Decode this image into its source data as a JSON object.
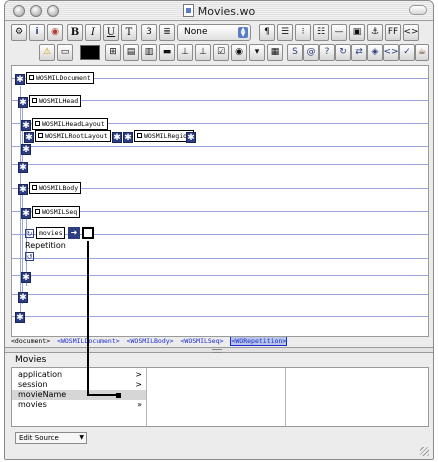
{
  "window": {
    "title": "Movies.wo"
  },
  "toolbar_row1": {
    "buttons": [
      {
        "name": "component-icon",
        "label": "⚙"
      },
      {
        "name": "info-icon",
        "label": "i"
      },
      {
        "name": "image-icon",
        "label": "◉"
      },
      {
        "name": "bold-button",
        "label": "B"
      },
      {
        "name": "italic-button",
        "label": "I"
      },
      {
        "name": "underline-button",
        "label": "U"
      },
      {
        "name": "teletype-button",
        "label": "T"
      },
      {
        "name": "superscript-button",
        "label": "3"
      },
      {
        "name": "paragraph-style-icon",
        "label": "≣"
      }
    ],
    "style_select": {
      "value": "None"
    },
    "right_buttons": [
      {
        "name": "paragraph-icon",
        "label": "¶"
      },
      {
        "name": "align-icon",
        "label": "☰"
      },
      {
        "name": "bulleted-list-icon",
        "label": "⁝"
      },
      {
        "name": "numbered-list-icon",
        "label": "☷"
      },
      {
        "name": "horizontal-rule-icon",
        "label": "—"
      },
      {
        "name": "image-insert-icon",
        "label": "▣"
      },
      {
        "name": "anchor-icon",
        "label": "⚓"
      },
      {
        "name": "frame-icon",
        "label": "FF"
      },
      {
        "name": "code-icon",
        "label": "<>"
      }
    ]
  },
  "toolbar_row2": {
    "buttons": [
      {
        "name": "warning-icon",
        "label": "⚠"
      },
      {
        "name": "cylinder-icon",
        "label": "▭"
      },
      {
        "name": "form-icon",
        "label": "⊞"
      },
      {
        "name": "text-field-icon",
        "label": "▤"
      },
      {
        "name": "text-area-icon",
        "label": "▥"
      },
      {
        "name": "button-icon",
        "label": "▬"
      },
      {
        "name": "submit-icon",
        "label": "⊥"
      },
      {
        "name": "reset-icon",
        "label": "⊥"
      },
      {
        "name": "checkbox-icon",
        "label": "☑"
      },
      {
        "name": "radio-icon",
        "label": "◉"
      },
      {
        "name": "popup-icon",
        "label": "▾"
      },
      {
        "name": "list-icon",
        "label": "▦"
      }
    ],
    "right_buttons": [
      {
        "name": "string-icon",
        "label": "S"
      },
      {
        "name": "hyperlink-icon",
        "label": "@"
      },
      {
        "name": "conditional-icon",
        "label": "?"
      },
      {
        "name": "repetition-icon",
        "label": "↻"
      },
      {
        "name": "switch-icon",
        "label": "⇄"
      },
      {
        "name": "wo-component-icon",
        "label": "◈"
      },
      {
        "name": "generic-icon",
        "label": "<>"
      },
      {
        "name": "keyvalue-icon",
        "label": "✓"
      },
      {
        "name": "custom-icon",
        "label": "☕"
      },
      {
        "name": "script-icon",
        "label": "❋"
      }
    ]
  },
  "editor": {
    "elements": {
      "document": "WOSMILDocument",
      "head": "WOSMILHead",
      "head_layout": "WOSMILHeadLayout",
      "root_layout": "WOSMILRootLayout",
      "region": "WOSMILRegion",
      "body": "WOSMILBody",
      "seq": "WOSMILSeq",
      "movies": "movies"
    },
    "repetition_label": "Repetition"
  },
  "pathbar": {
    "items": [
      "<document>",
      "<WOSMILDocument>",
      "<WOSMILBody>",
      "<WOSMILSeq>"
    ],
    "selected": "<WORepetition>"
  },
  "bindings": {
    "title": "Movies",
    "column1": [
      {
        "label": "application",
        "chevron": ">"
      },
      {
        "label": "session",
        "chevron": ">"
      },
      {
        "label": "movieName",
        "chevron": ""
      },
      {
        "label": "movies",
        "chevron": "»"
      }
    ]
  },
  "status": {
    "mode_select": "Edit Source"
  }
}
